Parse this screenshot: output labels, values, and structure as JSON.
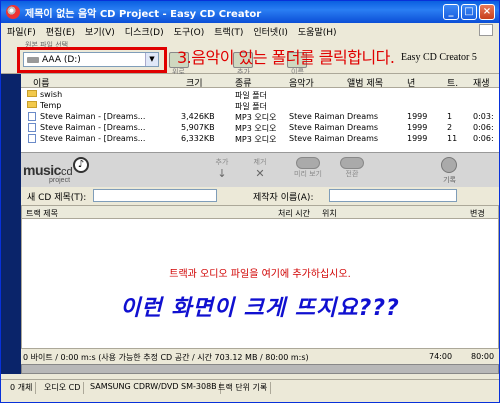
{
  "window": {
    "title": "제목이 없는 음악 CD Project - Easy CD Creator"
  },
  "menu": [
    "파일(F)",
    "편집(E)",
    "보기(V)",
    "디스크(D)",
    "도구(O)",
    "트랙(T)",
    "인터넷(I)",
    "도움말(H)"
  ],
  "location": {
    "caption": "원본 파일 선택",
    "drive": "AAA (D:)",
    "btn1_label": "위로",
    "btn2_label": "추가",
    "btn3_label": "이름",
    "annotation": "3.음악이 있는 폴더를 클릭합니다.",
    "brand": "Easy CD Creator 5"
  },
  "file_list": {
    "columns": [
      "이름",
      "크기",
      "종류",
      "음악가",
      "앨범 제목",
      "년",
      "트.",
      "재생"
    ],
    "rows": [
      {
        "name": "swish",
        "size": "",
        "type": "파일 폴더",
        "artist": "",
        "album": "",
        "year": "",
        "track": "",
        "time": "",
        "kind": "folder"
      },
      {
        "name": "Temp",
        "size": "",
        "type": "파일 폴더",
        "artist": "",
        "album": "",
        "year": "",
        "track": "",
        "time": "",
        "kind": "folder"
      },
      {
        "name": "Steve Raiman - [Dreams...",
        "size": "3,426KB",
        "type": "MP3 오디오",
        "artist": "Steve Raiman",
        "album": "Dreams",
        "year": "1999",
        "track": "1",
        "time": "0:03:",
        "kind": "file"
      },
      {
        "name": "Steve Raiman - [Dreams...",
        "size": "5,907KB",
        "type": "MP3 오디오",
        "artist": "Steve Raiman",
        "album": "Dreams",
        "year": "1999",
        "track": "2",
        "time": "0:06:",
        "kind": "file"
      },
      {
        "name": "Steve Raiman - [Dreams...",
        "size": "6,332KB",
        "type": "MP3 오디오",
        "artist": "Steve Raiman",
        "album": "Dreams",
        "year": "1999",
        "track": "11",
        "time": "0:06:",
        "kind": "file"
      }
    ]
  },
  "cd_panel": {
    "logo_music": "music",
    "logo_cd": "cd",
    "logo_project": "project",
    "tools": [
      {
        "label": "추가",
        "glyph": "↓"
      },
      {
        "label": "제거",
        "glyph": "✕"
      },
      {
        "label": "미리 보기",
        "glyph": ""
      },
      {
        "label": "전환",
        "glyph": ""
      }
    ],
    "record_label": "기록"
  },
  "fields": {
    "cd_title_label": "새 CD 제목(T):",
    "artist_label": "제작자 이름(A):"
  },
  "tracks": {
    "columns": [
      "트랙 제목",
      "처리 시간",
      "위치",
      "변경"
    ],
    "hint": "트랙과 오디오 파일을 여기에 추가하십시오.",
    "annotation": "이런 화면이 크게 뜨지요???"
  },
  "capacity": {
    "text": "0 바이트 / 0:00 m:s (사용 가능한 추정 CD 공간 / 시간  703.12 MB / 80:00 m:s)",
    "mark1": "74:00",
    "mark2": "80:00",
    "fill_fraction": 0.0
  },
  "statusbar": [
    "0 개체",
    "오디오 CD",
    "SAMSUNG CDRW/DVD SM-308B",
    "트랙 단위 기록"
  ]
}
